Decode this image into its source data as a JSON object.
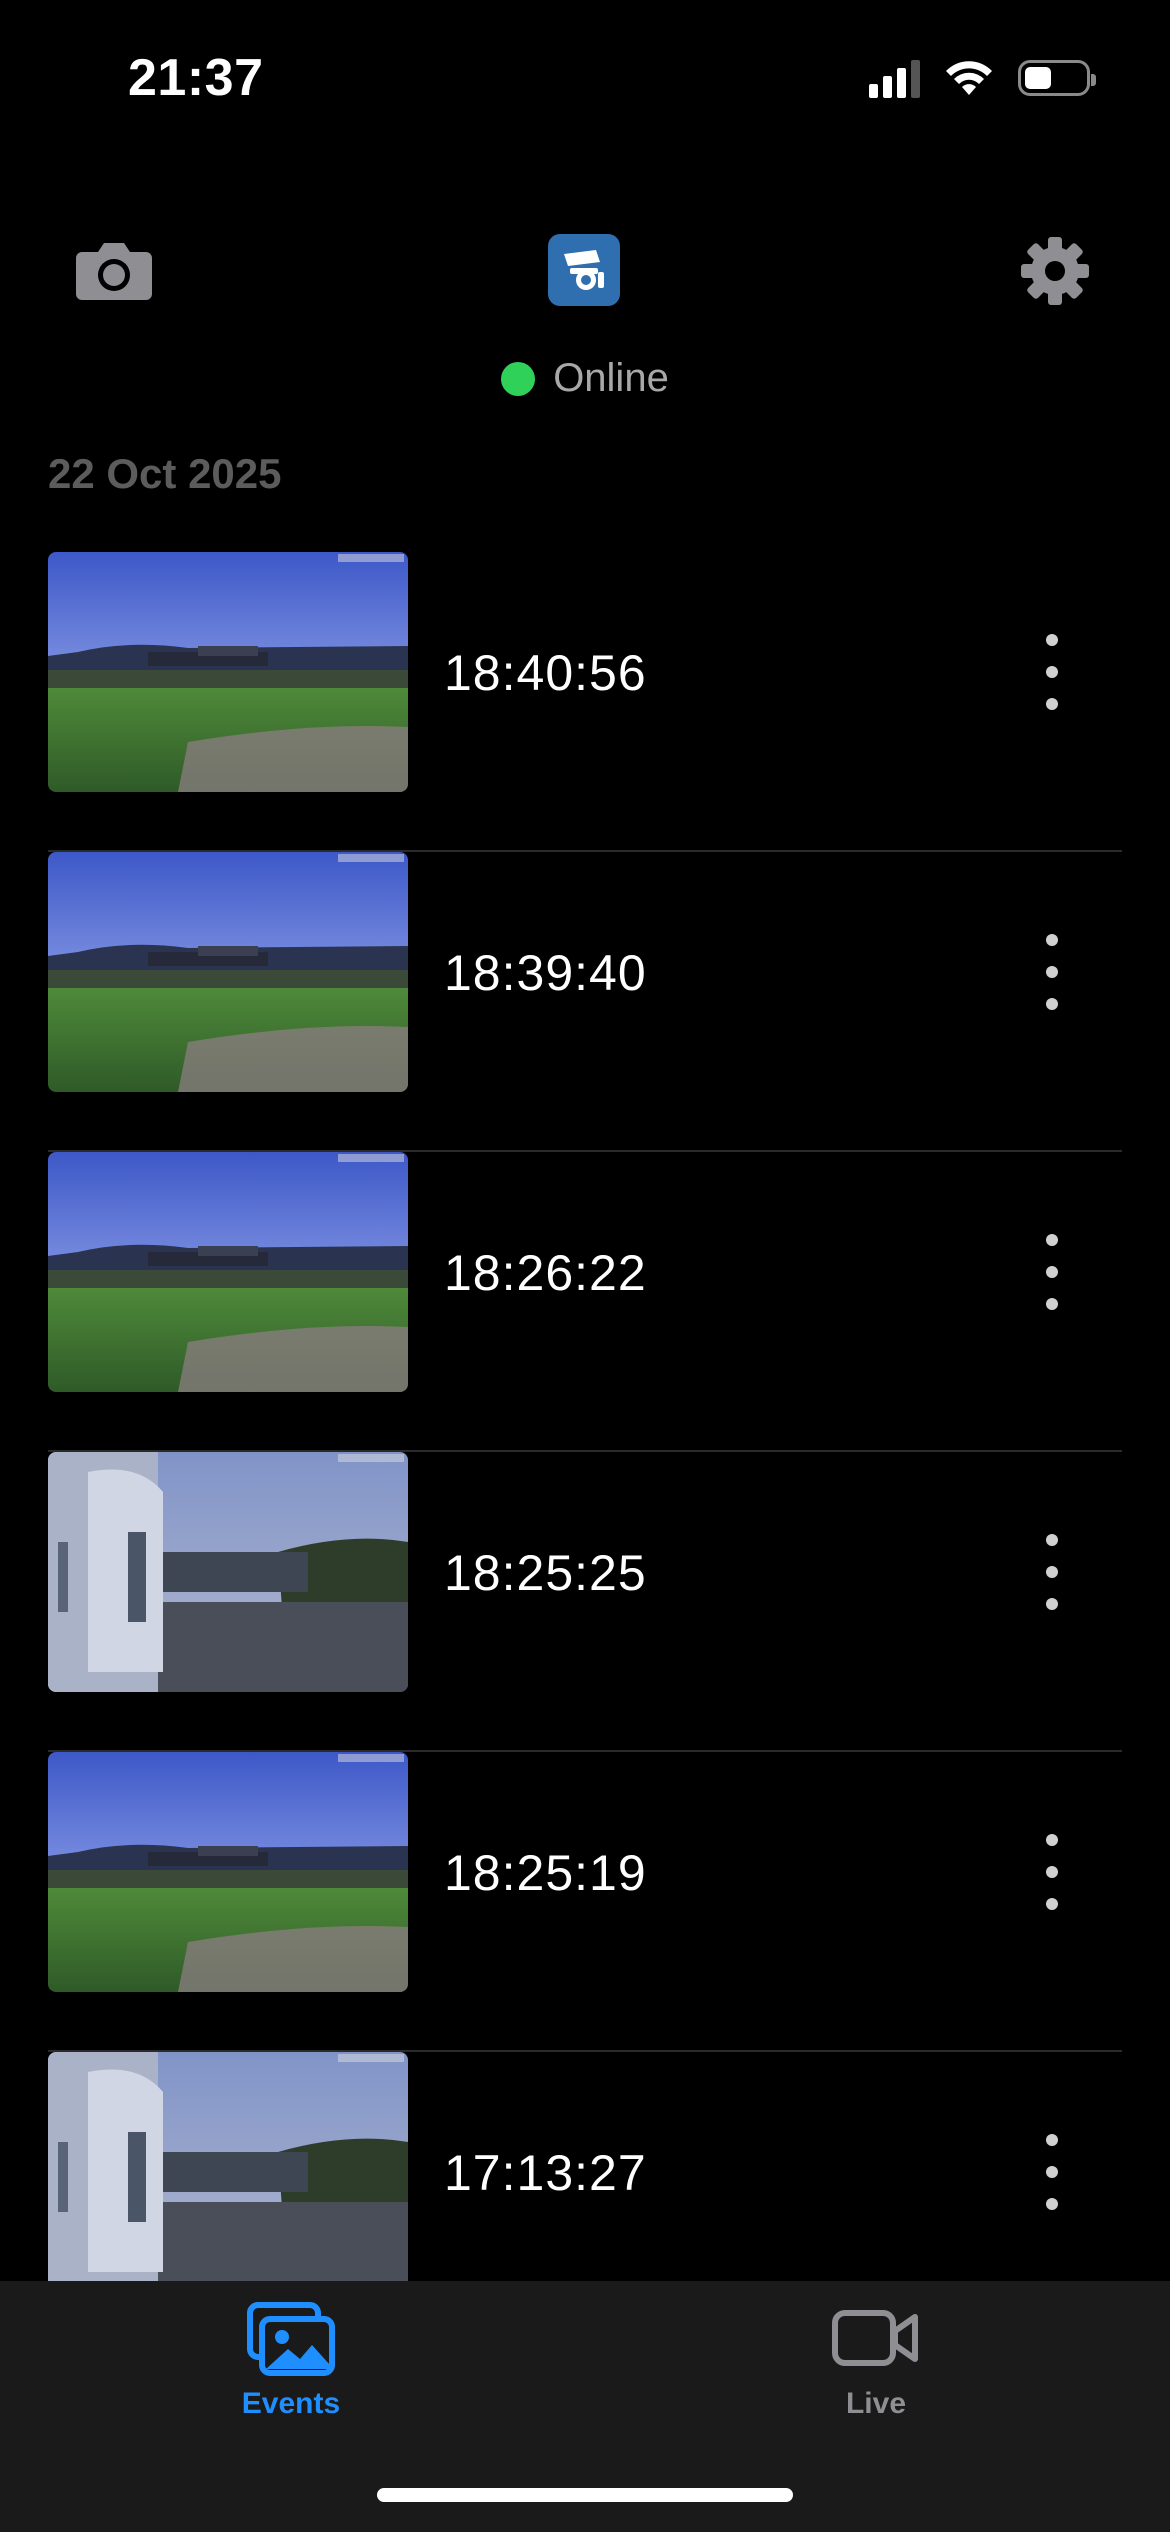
{
  "status_bar": {
    "time": "21:37"
  },
  "header": {
    "camera_icon": "camera-icon",
    "logo_icon": "security-camera-logo-icon",
    "settings_icon": "gear-icon",
    "status_text": "Online",
    "status_color": "#30d158"
  },
  "date_heading": "22 Oct 2025",
  "events": [
    {
      "time": "18:40:56",
      "scene": "lawn"
    },
    {
      "time": "18:39:40",
      "scene": "lawn"
    },
    {
      "time": "18:26:22",
      "scene": "lawn"
    },
    {
      "time": "18:25:25",
      "scene": "driveway"
    },
    {
      "time": "18:25:19",
      "scene": "lawn"
    },
    {
      "time": "17:13:27",
      "scene": "driveway"
    }
  ],
  "tab_bar": {
    "tabs": [
      {
        "label": "Events",
        "icon": "photos-icon",
        "active": true
      },
      {
        "label": "Live",
        "icon": "video-camera-icon",
        "active": false
      }
    ],
    "active_color": "#1f8fff",
    "inactive_color": "#8e8e93"
  }
}
